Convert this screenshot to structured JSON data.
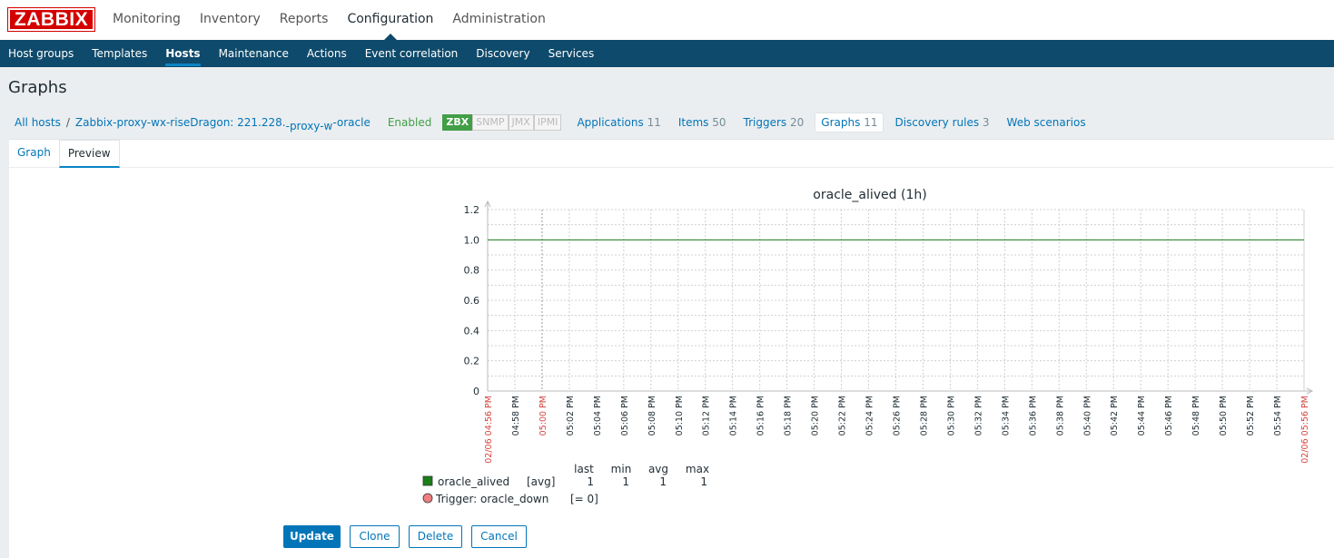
{
  "app": {
    "logo": "ZABBIX",
    "top_menu": [
      "Monitoring",
      "Inventory",
      "Reports",
      "Configuration",
      "Administration"
    ],
    "top_menu_active": "Configuration",
    "sub_menu": [
      "Host groups",
      "Templates",
      "Hosts",
      "Maintenance",
      "Actions",
      "Event correlation",
      "Discovery",
      "Services"
    ],
    "sub_menu_active": "Hosts"
  },
  "page": {
    "title": "Graphs"
  },
  "hostnav": {
    "all_hosts": "All hosts",
    "separator": "/",
    "host_name_a": "Zabbix-proxy-wx-riseDragon: 221.228.",
    "host_name_b": "-proxy-w",
    "host_name_c": "-oracle",
    "status": "Enabled",
    "availability": [
      "ZBX",
      "SNMP",
      "JMX",
      "IPMI"
    ],
    "applications": {
      "label": "Applications",
      "count": "11"
    },
    "items": {
      "label": "Items",
      "count": "50"
    },
    "triggers": {
      "label": "Triggers",
      "count": "20"
    },
    "graphs": {
      "label": "Graphs",
      "count": "11"
    },
    "discovery_rules": {
      "label": "Discovery rules",
      "count": "3"
    },
    "web_scenarios": {
      "label": "Web scenarios"
    }
  },
  "tabs": {
    "graph": "Graph",
    "preview": "Preview"
  },
  "chart_data": {
    "type": "line",
    "title": "oracle_alived (1h)",
    "ylim": [
      0,
      1.2
    ],
    "y_ticks": [
      "1.2",
      "1.0",
      "0.8",
      "0.6",
      "0.4",
      "0.2",
      "0"
    ],
    "x_start_label": "02/06 04:56 PM",
    "x_end_label": "02/06 05:56 PM",
    "x_tick_labels": [
      "04:58 PM",
      "05:00 PM",
      "05:02 PM",
      "05:04 PM",
      "05:06 PM",
      "05:08 PM",
      "05:10 PM",
      "05:12 PM",
      "05:14 PM",
      "05:16 PM",
      "05:18 PM",
      "05:20 PM",
      "05:22 PM",
      "05:24 PM",
      "05:26 PM",
      "05:28 PM",
      "05:30 PM",
      "05:32 PM",
      "05:34 PM",
      "05:36 PM",
      "05:38 PM",
      "05:40 PM",
      "05:42 PM",
      "05:44 PM",
      "05:46 PM",
      "05:48 PM",
      "05:50 PM",
      "05:52 PM",
      "05:54 PM"
    ],
    "x_tick_highlight": "05:00 PM",
    "series": [
      {
        "name": "oracle_alived",
        "func": "[avg]",
        "color": "#1a7d1a",
        "values": [
          1,
          1
        ],
        "last": "1",
        "min": "1",
        "avg": "1",
        "max": "1"
      }
    ],
    "legend_headers": [
      "last",
      "min",
      "avg",
      "max"
    ],
    "trigger": {
      "label": "Trigger: oracle_down",
      "condition": "[= 0]",
      "color": "#f08080"
    },
    "grid": true
  },
  "buttons": {
    "update": "Update",
    "clone": "Clone",
    "delete": "Delete",
    "cancel": "Cancel"
  },
  "colors": {
    "brand": "#d40000",
    "nav": "#0e4a6b",
    "link": "#0275b8",
    "enabled": "#429e47"
  }
}
